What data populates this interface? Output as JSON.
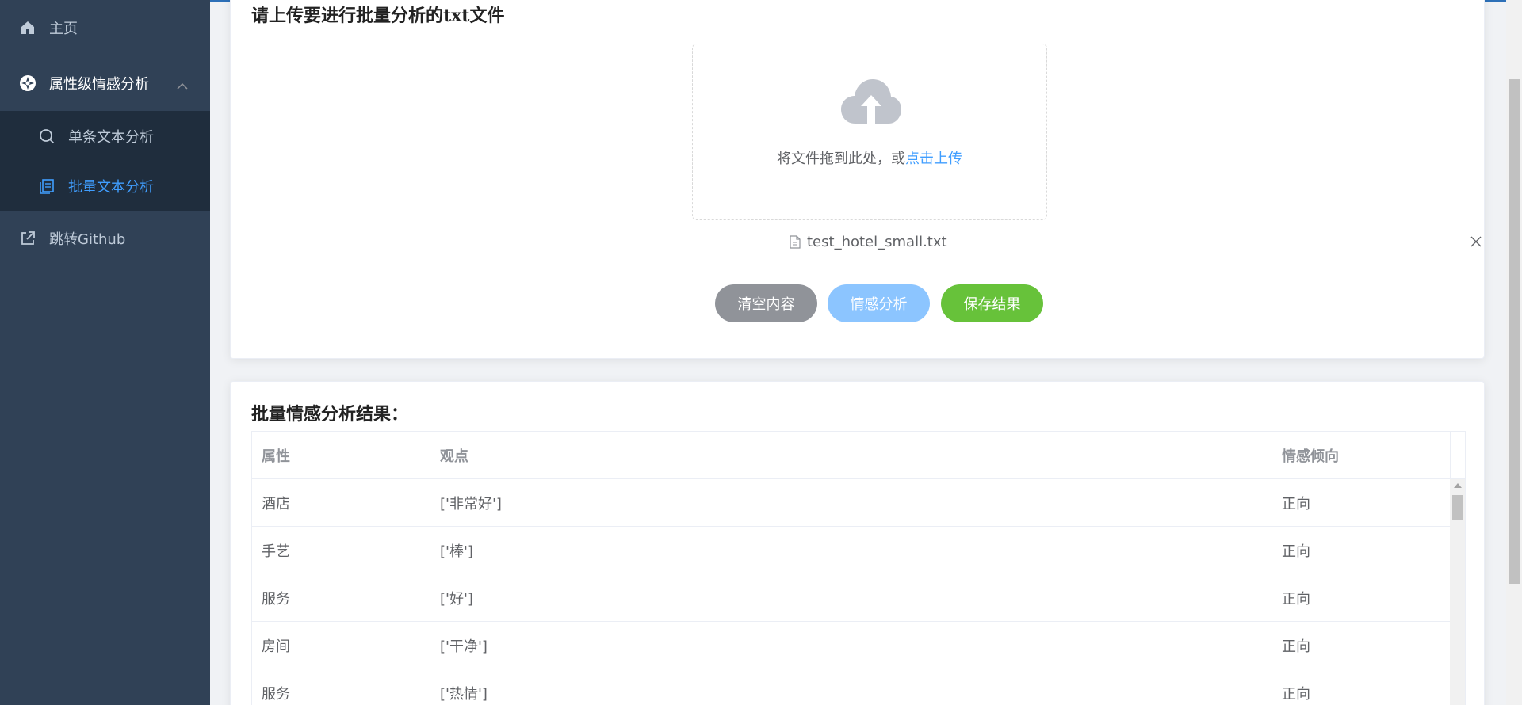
{
  "sidebar": {
    "home": {
      "label": "主页",
      "icon": "home-icon"
    },
    "analysis_menu": {
      "label": "属性级情感分析",
      "icon": "aperture-icon",
      "expanded": true,
      "items": [
        {
          "label": "单条文本分析",
          "icon": "search-icon",
          "active": false
        },
        {
          "label": "批量文本分析",
          "icon": "copy-document-icon",
          "active": true
        }
      ]
    },
    "github": {
      "label": "跳转Github",
      "icon": "external-link-icon"
    }
  },
  "upload": {
    "title": "请上传要进行批量分析的txt文件",
    "drop_text": "将文件拖到此处，或",
    "drop_link": "点击上传",
    "file_name": "test_hotel_small.txt",
    "buttons": {
      "clear": "清空内容",
      "analyze": "情感分析",
      "save": "保存结果"
    }
  },
  "results": {
    "title": "批量情感分析结果：",
    "columns": [
      "属性",
      "观点",
      "情感倾向"
    ],
    "rows": [
      {
        "attribute": "酒店",
        "opinion": "['非常好']",
        "sentiment": "正向"
      },
      {
        "attribute": "手艺",
        "opinion": "['棒']",
        "sentiment": "正向"
      },
      {
        "attribute": "服务",
        "opinion": "['好']",
        "sentiment": "正向"
      },
      {
        "attribute": "房间",
        "opinion": "['干净']",
        "sentiment": "正向"
      },
      {
        "attribute": "服务",
        "opinion": "['热情']",
        "sentiment": "正向"
      }
    ]
  },
  "colors": {
    "sidebar_bg": "#304156",
    "submenu_bg": "#1f2d3d",
    "accent": "#409eff",
    "clear_button": "#909399",
    "analyze_button": "#8cc5ff",
    "save_button": "#67c23a"
  }
}
